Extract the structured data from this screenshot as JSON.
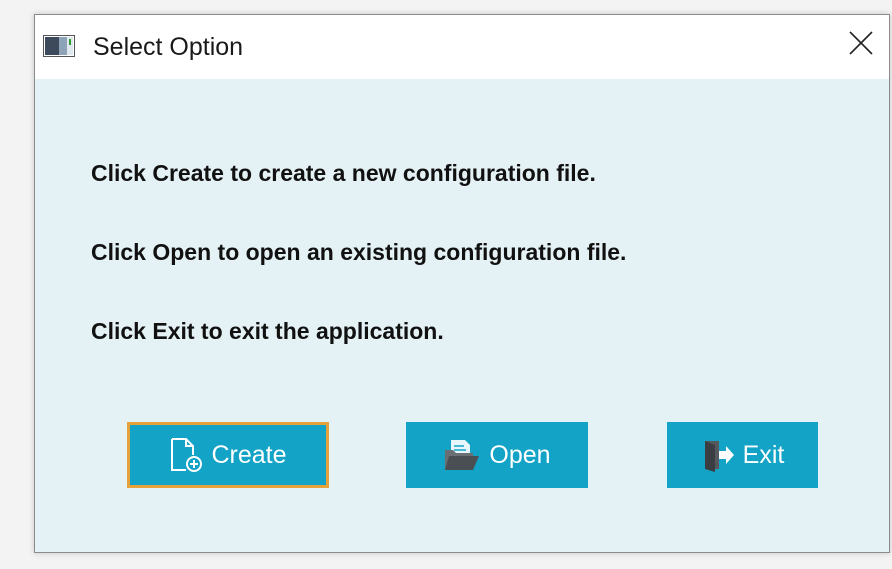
{
  "window": {
    "title": "Select Option",
    "icons": {
      "app": "app-window-icon",
      "close": "close-icon"
    }
  },
  "messages": [
    "Click Create to create a new configuration file.",
    "Click Open to open an existing configuration file.",
    "Click Exit to exit the application."
  ],
  "buttons": {
    "create": {
      "label": "Create",
      "icon": "new-file-icon",
      "focused": true
    },
    "open": {
      "label": "Open",
      "icon": "open-folder-icon"
    },
    "exit": {
      "label": "Exit",
      "icon": "exit-door-icon"
    }
  },
  "colors": {
    "button_bg": "#12a3c6",
    "focus_border": "#e6a33a",
    "client_bg": "#e4f1f5"
  }
}
